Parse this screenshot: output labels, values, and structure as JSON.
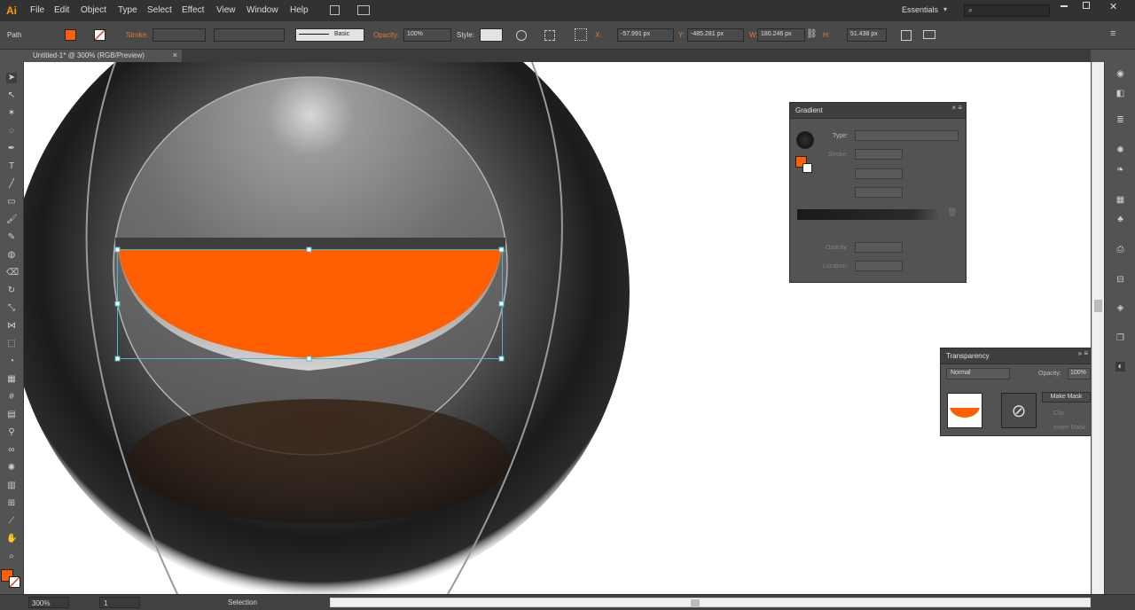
{
  "app": {
    "logo": "Ai"
  },
  "menus": [
    "File",
    "Edit",
    "Object",
    "Type",
    "Select",
    "Effect",
    "View",
    "Window",
    "Help"
  ],
  "workspace": {
    "name": "Essentials",
    "search_placeholder": ""
  },
  "control": {
    "path_label": "Path",
    "stroke_label": "Stroke:",
    "brush_label": "Basic",
    "opacity_label": "Opacity:",
    "opacity_value": "100%",
    "style_label": "Style:",
    "x_label": "X:",
    "x_value": "-57.991 px",
    "y_label": "Y:",
    "y_value": "-485.281 px",
    "w_label": "W:",
    "w_value": "180.246 px",
    "h_label": "H:",
    "h_value": "51.438 px"
  },
  "document": {
    "tab_title": "Untitled-1* @ 300% (RGB/Preview)"
  },
  "gradient": {
    "title": "Gradient",
    "type_label": "Type:",
    "stroke_label": "Stroke:",
    "opacity_label": "Opacity:",
    "location_label": "Location:"
  },
  "transparency": {
    "title": "Transparency",
    "blend_mode": "Normal",
    "opacity_label": "Opacity:",
    "opacity_value": "100%",
    "make_mask_label": "Make Mask",
    "clip_label": "Clip",
    "invert_mask_label": "Invert Mask"
  },
  "status": {
    "zoom": "300%",
    "artboard": "1",
    "tool": "Selection"
  },
  "colors": {
    "accent_orange": "#ff5f00",
    "panel_bg": "#535353"
  }
}
